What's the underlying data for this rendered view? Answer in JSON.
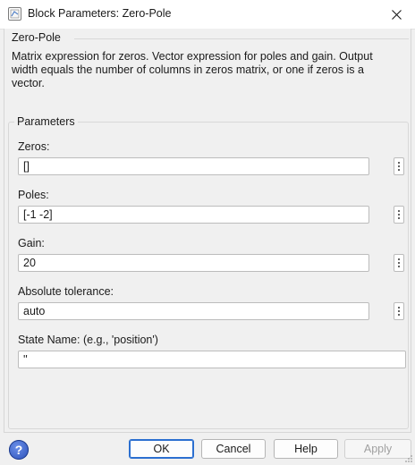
{
  "window": {
    "title": "Block Parameters: Zero-Pole"
  },
  "block_group": {
    "title": "Zero-Pole",
    "description": "Matrix expression for zeros.  Vector expression for poles and gain.  Output width equals the number of columns in zeros matrix, or one if zeros is a vector."
  },
  "parameters": {
    "title": "Parameters",
    "fields": [
      {
        "label": "Zeros:",
        "value": "[]"
      },
      {
        "label": "Poles:",
        "value": "[-1 -2]"
      },
      {
        "label": "Gain:",
        "value": "20"
      },
      {
        "label": "Absolute tolerance:",
        "value": "auto"
      },
      {
        "label": "State Name: (e.g., 'position')",
        "value": "''"
      }
    ]
  },
  "buttons": {
    "ok": "OK",
    "cancel": "Cancel",
    "help": "Help",
    "apply": "Apply"
  },
  "colors": {
    "accent": "#2b6fd0",
    "disabled_text": "#a0a0a0"
  }
}
